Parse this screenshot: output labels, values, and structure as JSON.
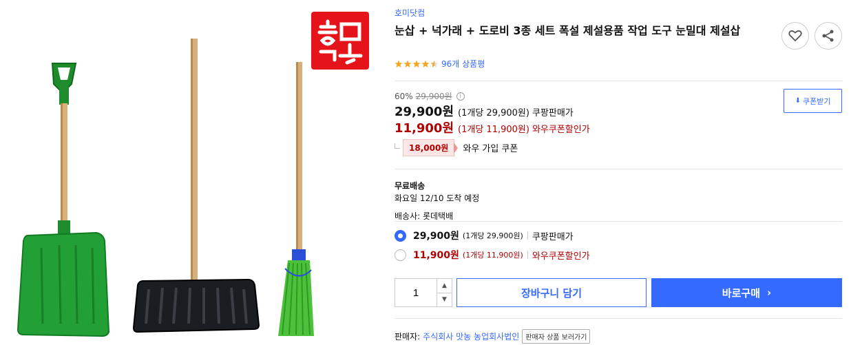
{
  "product": {
    "brand": "호미닷컴",
    "title": "눈삽 + 넉가래 + 도로비 3종 세트 폭설 제설용품 작업 도구 눈밀대 제설삽",
    "rating_stars": 4.5,
    "review_count": "96개 상품평",
    "favorite_icon": "heart-icon",
    "share_icon": "share-icon"
  },
  "price": {
    "discount_rate": "60%",
    "original_price": "29,900원",
    "sale_price": "29,900원",
    "sale_unit": "(1개당 29,900원)",
    "sale_label": "쿠팡판매가",
    "coupon_price": "11,900원",
    "coupon_unit": "(1개당 11,900원)",
    "coupon_label": "와우쿠폰할인가",
    "coupon_button": "쿠폰받기",
    "wow_amount": "18,000원",
    "wow_label": "와우 가입 쿠폰"
  },
  "shipping": {
    "free": "무료배송",
    "arrival": "화요일 12/10 도착 예정",
    "carrier": "배송사: 롯데택배"
  },
  "options": [
    {
      "price": "29,900원",
      "unit": "(1개당 29,900원)",
      "label": "쿠팡판매가",
      "selected": true
    },
    {
      "price": "11,900원",
      "unit": "(1개당 11,900원)",
      "label": "와우쿠폰할인가",
      "selected": false
    }
  ],
  "purchase": {
    "quantity": "1",
    "cart_label": "장바구니 담기",
    "buy_label": "바로구매"
  },
  "seller": {
    "prefix": "판매자:",
    "name": "주식회사 맛농 농업회사법인",
    "link_label": "판매자 상품 보러가기"
  },
  "colors": {
    "accent": "#346aff",
    "price_red": "#ae0000",
    "logo_red": "#e4141a"
  }
}
